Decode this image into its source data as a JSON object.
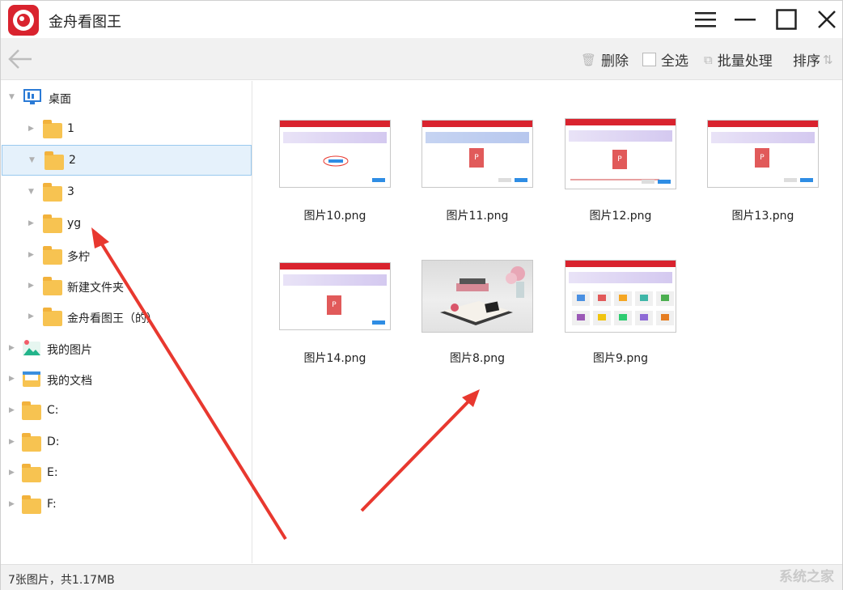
{
  "app": {
    "title": "金舟看图王"
  },
  "toolbar": {
    "delete_label": "删除",
    "select_all_label": "全选",
    "batch_label": "批量处理",
    "sort_label": "排序"
  },
  "sidebar": {
    "desktop": "桌面",
    "folders": [
      "1",
      "2",
      "3",
      "yg",
      "多柠",
      "新建文件夹",
      "金舟看图王（的）"
    ],
    "my_pictures": "我的图片",
    "my_documents": "我的文档",
    "drives": [
      "C:",
      "D:",
      "E:",
      "F:"
    ]
  },
  "images": [
    {
      "name": "图片10.png"
    },
    {
      "name": "图片11.png"
    },
    {
      "name": "图片12.png"
    },
    {
      "name": "图片13.png"
    },
    {
      "name": "图片14.png"
    },
    {
      "name": "图片8.png"
    },
    {
      "name": "图片9.png"
    }
  ],
  "status": {
    "text": "7张图片，共1.17MB"
  },
  "watermark": "系统之家",
  "colors": {
    "brand": "#d9232e",
    "selected_bg": "#e5f1fb",
    "folder": "#f7c351",
    "arrow": "#e8382f"
  }
}
